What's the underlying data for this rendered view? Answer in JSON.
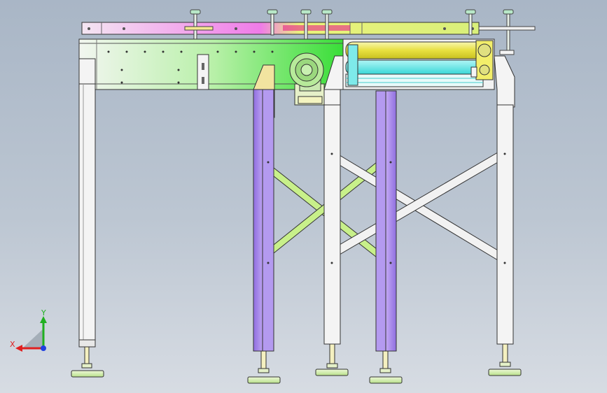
{
  "viewport": {
    "background_top": "#a9b6c6",
    "background_bottom": "#d7dce3"
  },
  "colors": {
    "leg_white": "#f4f4f4",
    "leg_purple": "#a98be8",
    "brace_green": "#c8f08a",
    "brace_white": "#f2f2f2",
    "rail_magenta": "#f07be8",
    "rail_yellow": "#eaf27a",
    "frame_green": "#5be05b",
    "roller_yellow": "#f2ee6a",
    "roller_cyan": "#6ee6e6",
    "foot_green": "#d6f0b0",
    "outline": "#333333"
  },
  "triad": {
    "x_label": "X",
    "y_label": "Y",
    "x_color": "#e02020",
    "y_color": "#20b020",
    "z_color": "#2040e0"
  }
}
